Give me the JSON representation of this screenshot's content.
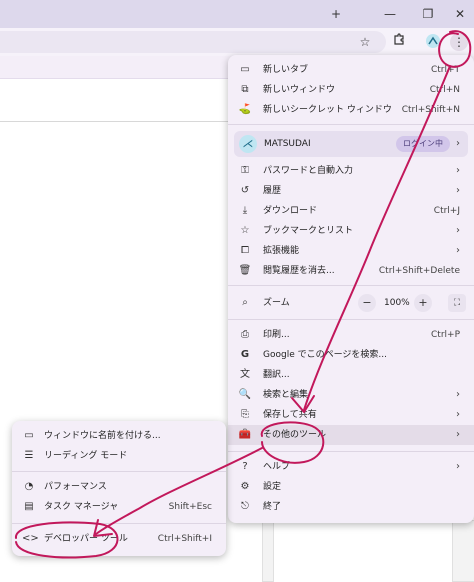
{
  "window": {
    "new_tab_symbol": "+",
    "minimize_symbol": "—",
    "restore_symbol": "❐",
    "close_symbol": "✕"
  },
  "toolbar": {
    "icons": [
      "star-icon",
      "extensions-icon",
      "profile-icon",
      "menu-kebab-icon"
    ]
  },
  "menu": {
    "new_tab": {
      "label": "新しいタブ",
      "shortcut": "Ctrl+T"
    },
    "new_window": {
      "label": "新しいウィンドウ",
      "shortcut": "Ctrl+N"
    },
    "incognito": {
      "label": "新しいシークレット ウィンドウ",
      "shortcut": "Ctrl+Shift+N"
    },
    "profile": {
      "name": "MATSUDAI",
      "status": "ログイン中"
    },
    "passwords": {
      "label": "パスワードと自動入力"
    },
    "history": {
      "label": "履歴"
    },
    "downloads": {
      "label": "ダウンロード",
      "shortcut": "Ctrl+J"
    },
    "bookmarks": {
      "label": "ブックマークとリスト"
    },
    "extensions": {
      "label": "拡張機能"
    },
    "clear_data": {
      "label": "閲覧履歴を消去...",
      "shortcut": "Ctrl+Shift+Delete"
    },
    "zoom": {
      "label": "ズーム",
      "minus": "−",
      "value": "100%",
      "plus": "+"
    },
    "print": {
      "label": "印刷...",
      "shortcut": "Ctrl+P"
    },
    "google_search": {
      "label": "Google でこのページを検索..."
    },
    "translate": {
      "label": "翻訳..."
    },
    "find_edit": {
      "label": "検索と編集"
    },
    "save_share": {
      "label": "保存して共有"
    },
    "more_tools": {
      "label": "その他のツール"
    },
    "help": {
      "label": "ヘルプ"
    },
    "settings": {
      "label": "設定"
    },
    "exit": {
      "label": "終了"
    }
  },
  "submenu": {
    "name_window": {
      "label": "ウィンドウに名前を付ける..."
    },
    "reading_mode": {
      "label": "リーディング モード"
    },
    "performance": {
      "label": "パフォーマンス"
    },
    "task_manager": {
      "label": "タスク マネージャ",
      "shortcut": "Shift+Esc"
    },
    "devtools": {
      "label": "デベロッパー ツール",
      "shortcut": "Ctrl+Shift+I"
    }
  },
  "colors": {
    "menu_bg": "#f4eef8",
    "highlight": "#e4dce8",
    "annotation": "#c2185b",
    "titlebar": "#ddd8ec"
  }
}
